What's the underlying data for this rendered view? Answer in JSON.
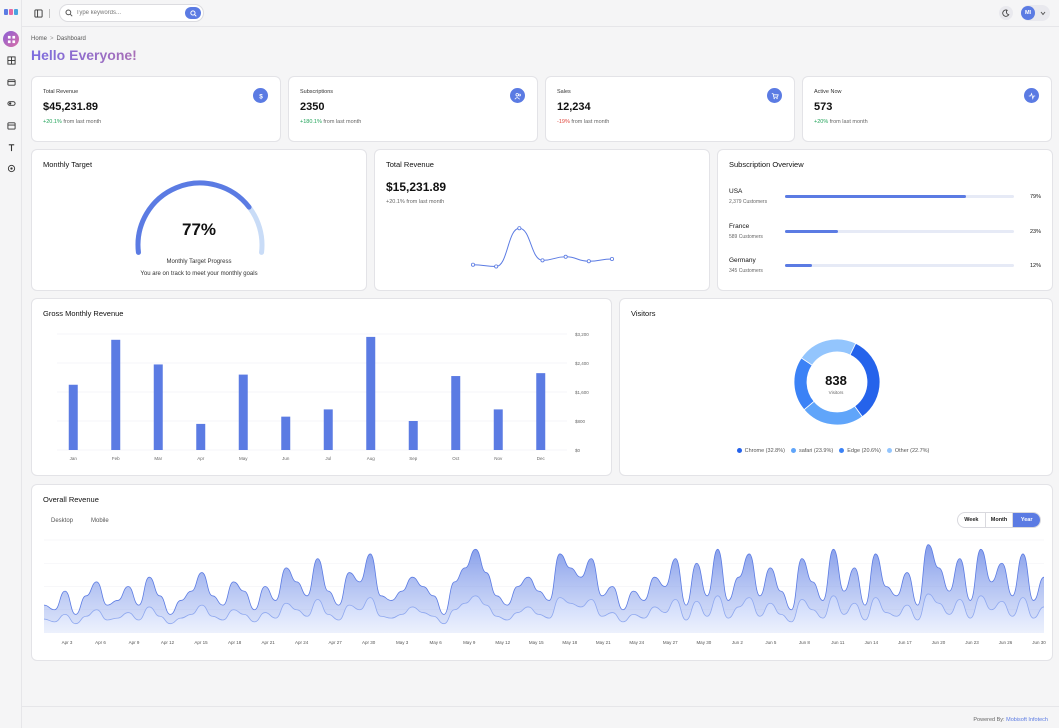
{
  "header": {
    "search_placeholder": "Type keywords...",
    "avatar_initials": "MI"
  },
  "breadcrumb": {
    "home": "Home",
    "sep": ">",
    "current": "Dashboard"
  },
  "greeting": "Hello Everyone!",
  "stats": [
    {
      "label": "Total Revenue",
      "value": "$45,231.89",
      "change": "+20.1%",
      "change_suffix": "from last month",
      "icon": "dollar-icon"
    },
    {
      "label": "Subscriptions",
      "value": "2350",
      "change": "+180.1%",
      "change_suffix": "from last month",
      "icon": "users-icon"
    },
    {
      "label": "Sales",
      "value": "12,234",
      "change": "-19%",
      "change_suffix": "from last month",
      "icon": "cart-icon"
    },
    {
      "label": "Active Now",
      "value": "573",
      "change": "+20%",
      "change_suffix": "from last month",
      "icon": "activity-icon"
    }
  ],
  "monthly_target": {
    "title": "Monthly Target",
    "percent_label": "77%",
    "progress": 0.77,
    "caption": "Monthly Target Progress",
    "message": "You are on track to meet your monthly goals"
  },
  "total_revenue": {
    "title": "Total Revenue",
    "value": "$15,231.89",
    "change": "+20.1% from last month"
  },
  "subscription_overview": {
    "title": "Subscription Overview",
    "items": [
      {
        "name": "USA",
        "count": "2,379 Customers",
        "pct_label": "79%",
        "pct": 79
      },
      {
        "name": "France",
        "count": "589 Customers",
        "pct_label": "23%",
        "pct": 23
      },
      {
        "name": "Germany",
        "count": "345 Customers",
        "pct_label": "12%",
        "pct": 12
      }
    ]
  },
  "gross_revenue": {
    "title": "Gross Monthly Revenue"
  },
  "visitors": {
    "title": "Visitors",
    "total": "838",
    "total_label": "Visitors",
    "legend": [
      {
        "label": "Chrome (32.8%)",
        "color": "#2563eb"
      },
      {
        "label": "safari (23.9%)",
        "color": "#60a5fa"
      },
      {
        "label": "Edge (20.6%)",
        "color": "#3b82f6"
      },
      {
        "label": "Other (22.7%)",
        "color": "#93c5fd"
      }
    ]
  },
  "overall_revenue": {
    "title": "Overall Revenue",
    "tabs": [
      "Desktop",
      "Mobile"
    ],
    "range_buttons": [
      "Week",
      "Month",
      "Year"
    ],
    "active_range": "Year"
  },
  "footer": {
    "prefix": "Powered By:",
    "brand": "Mobisoft Infotech"
  },
  "chart_data": [
    {
      "type": "line",
      "x": [
        1,
        2,
        3,
        4,
        5,
        6,
        7
      ],
      "values": [
        12,
        8,
        95,
        22,
        30,
        20,
        25
      ],
      "ylim": [
        0,
        100
      ]
    },
    {
      "type": "bar",
      "categories": [
        "Jan",
        "Feb",
        "Mar",
        "Apr",
        "May",
        "Jun",
        "Jul",
        "Aug",
        "Sep",
        "Oct",
        "Nov",
        "Dec"
      ],
      "values": [
        2250,
        3800,
        2950,
        900,
        2600,
        1150,
        1400,
        3900,
        1000,
        2550,
        1400,
        2650
      ],
      "ylim": [
        0,
        4000
      ],
      "yticks": [
        0,
        1000,
        2000,
        3000,
        4000
      ],
      "ytick_labels": [
        "$0",
        "$800",
        "$1,600",
        "$2,400",
        "$3,200"
      ],
      "grid": true
    },
    {
      "type": "pie",
      "labels": [
        "Chrome",
        "safari",
        "Edge",
        "Other"
      ],
      "values": [
        32.8,
        23.9,
        20.6,
        22.7
      ],
      "colors": [
        "#2563eb",
        "#60a5fa",
        "#3b82f6",
        "#93c5fd"
      ]
    },
    {
      "type": "area",
      "x_labels": [
        "Apr 3",
        "Apr 6",
        "Apr 9",
        "Apr 12",
        "Apr 15",
        "Apr 18",
        "Apr 21",
        "Apr 24",
        "Apr 27",
        "Apr 30",
        "May 3",
        "May 6",
        "May 9",
        "May 12",
        "May 15",
        "May 18",
        "May 21",
        "May 24",
        "May 27",
        "May 30",
        "Jun 2",
        "Jun 5",
        "Jun 8",
        "Jun 11",
        "Jun 14",
        "Jun 17",
        "Jun 20",
        "Jun 23",
        "Jun 26",
        "Jun 30"
      ],
      "series": [
        {
          "values": [
            30,
            25,
            45,
            20,
            40,
            55,
            30,
            35,
            50,
            30,
            60,
            40,
            20,
            35,
            45,
            65,
            40,
            30,
            55,
            45,
            25,
            50,
            35,
            70,
            55,
            40,
            80,
            45,
            30,
            65,
            55,
            85,
            40,
            35,
            45,
            60,
            50,
            40,
            20,
            55,
            70,
            90,
            65,
            40,
            30,
            50,
            60,
            45,
            35,
            85,
            70,
            60,
            80,
            40,
            50,
            25,
            45,
            35,
            60,
            50,
            80,
            30,
            75,
            40,
            90,
            35,
            60,
            85,
            40,
            70,
            45,
            25,
            80,
            55,
            35,
            90,
            45,
            70,
            30,
            85,
            50,
            40,
            65,
            30,
            95,
            70,
            45,
            80,
            35,
            90,
            55,
            75,
            40,
            85,
            35,
            60
          ]
        },
        {
          "values": [
            15,
            12,
            20,
            10,
            18,
            25,
            14,
            16,
            22,
            14,
            28,
            18,
            10,
            16,
            20,
            30,
            18,
            14,
            25,
            20,
            12,
            22,
            16,
            32,
            25,
            18,
            36,
            20,
            14,
            30,
            25,
            38,
            18,
            16,
            20,
            28,
            22,
            18,
            10,
            25,
            32,
            40,
            30,
            18,
            14,
            22,
            28,
            20,
            16,
            38,
            32,
            28,
            36,
            18,
            22,
            12,
            20,
            16,
            28,
            22,
            36,
            14,
            34,
            18,
            40,
            16,
            28,
            38,
            18,
            32,
            20,
            12,
            36,
            25,
            16,
            40,
            20,
            32,
            14,
            38,
            22,
            18,
            30,
            14,
            42,
            32,
            20,
            36,
            16,
            40,
            25,
            34,
            18,
            38,
            16,
            28
          ]
        }
      ],
      "ylim": [
        0,
        100
      ]
    }
  ]
}
